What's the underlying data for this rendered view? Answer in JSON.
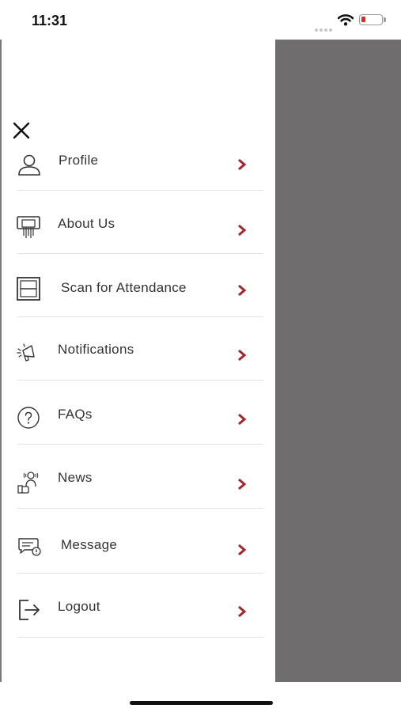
{
  "status_bar": {
    "time": "11:31",
    "icons": [
      "signal-dots-icon",
      "wifi-icon",
      "battery-low-icon"
    ],
    "battery_color": "#e0281e"
  },
  "drawer": {
    "close_icon": "close-icon",
    "chevron_color": "#a0282a",
    "overlay_color": "#6f6d6e",
    "items": [
      {
        "label": "Profile",
        "icon": "user-icon"
      },
      {
        "label": "About Us",
        "icon": "about-icon"
      },
      {
        "label": "Scan for Attendance",
        "icon": "scan-icon"
      },
      {
        "label": "Notifications",
        "icon": "megaphone-icon"
      },
      {
        "label": "FAQs",
        "icon": "question-icon"
      },
      {
        "label": "News",
        "icon": "news-icon"
      },
      {
        "label": "Message",
        "icon": "message-icon"
      },
      {
        "label": "Logout",
        "icon": "logout-icon"
      }
    ]
  }
}
